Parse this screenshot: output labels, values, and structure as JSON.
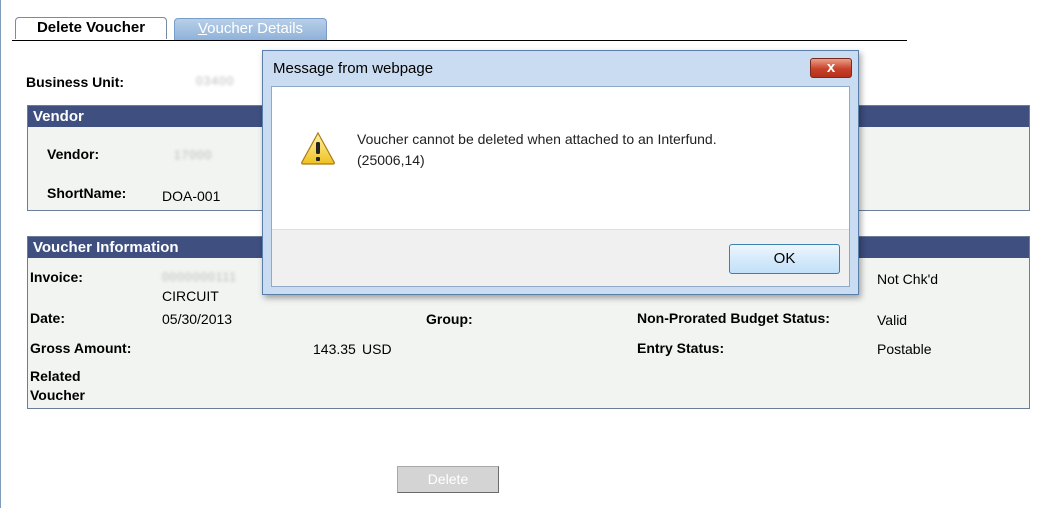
{
  "tabs": {
    "active_label": "Delete Voucher",
    "inactive_label_first": "V",
    "inactive_label_rest": "oucher Details"
  },
  "business_unit": {
    "label": "Business Unit:",
    "value": "03400"
  },
  "vendor_section": {
    "header": "Vendor",
    "vendor_label": "Vendor:",
    "vendor_value": "17000",
    "shortname_label": "ShortName:",
    "shortname_value": "DOA-001"
  },
  "voucher_info": {
    "header": "Voucher Information",
    "invoice_label": "Invoice:",
    "invoice_value": "0000000111",
    "invoice_value_line2": "CIRCUIT",
    "date_label": "Date:",
    "date_value": "05/30/2013",
    "group_label": "Group:",
    "gross_label": "Gross Amount:",
    "gross_value": "143.35",
    "currency": "USD",
    "budget_label": "Non-Prorated Budget Status:",
    "budget_value": "Valid",
    "budget_check_value": "Not Chk'd",
    "entry_status_label": "Entry Status:",
    "entry_status_value": "Postable",
    "related_label_line1": "Related",
    "related_label_line2": "Voucher"
  },
  "delete_button": "Delete",
  "dialog": {
    "title": "Message from webpage",
    "close_glyph": "x",
    "message_line1": "Voucher cannot be deleted when attached to an Interfund.",
    "message_line2": "(25006,14)",
    "ok_label": "OK",
    "icon": "warning-icon"
  },
  "colors": {
    "section_header_bg": "#3f4f80",
    "dialog_frame": "#c9dcf1",
    "close_button": "#c8422a"
  }
}
